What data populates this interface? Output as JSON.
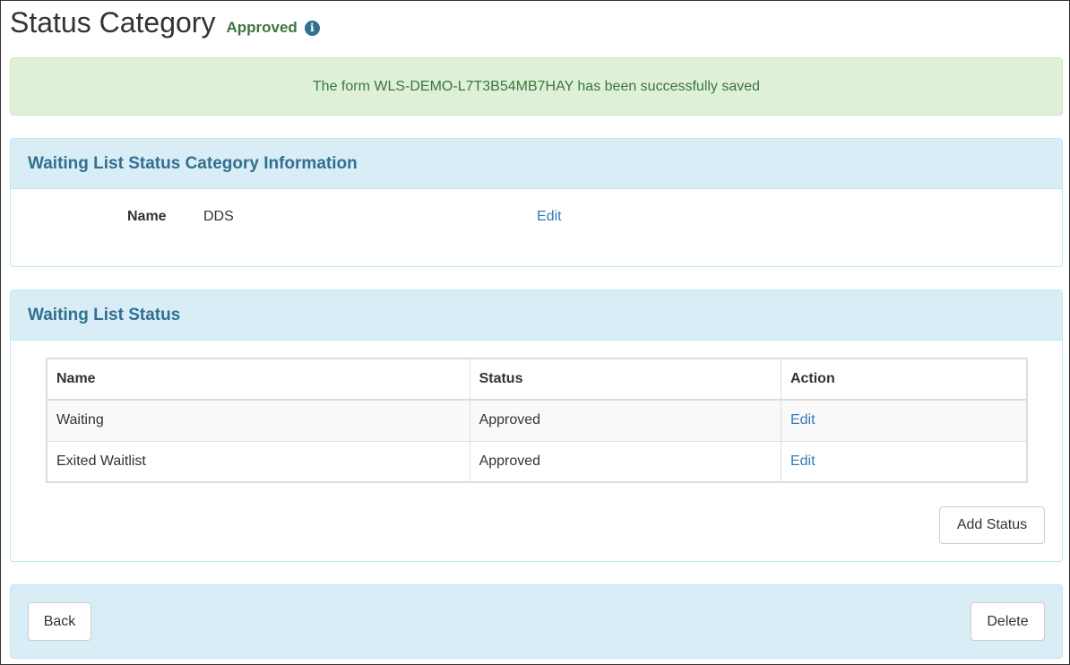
{
  "page": {
    "title": "Status Category",
    "status": "Approved",
    "info_icon": "info-circle-icon"
  },
  "alert": {
    "message": "The form WLS-DEMO-L7T3B54MB7HAY has been successfully saved"
  },
  "category_panel": {
    "heading": "Waiting List Status Category Information",
    "name_label": "Name",
    "name_value": "DDS",
    "edit_label": "Edit"
  },
  "status_panel": {
    "heading": "Waiting List Status",
    "columns": [
      "Name",
      "Status",
      "Action"
    ],
    "rows": [
      {
        "name": "Waiting",
        "status": "Approved",
        "action": "Edit"
      },
      {
        "name": "Exited Waitlist",
        "status": "Approved",
        "action": "Edit"
      }
    ],
    "add_button": "Add Status"
  },
  "footer": {
    "back_button": "Back",
    "delete_button": "Delete"
  },
  "colors": {
    "success_text": "#3c763d",
    "success_bg": "#dff0d8",
    "panel_heading_bg": "#d9edf7",
    "panel_heading_text": "#31708f",
    "link": "#337ab7"
  }
}
